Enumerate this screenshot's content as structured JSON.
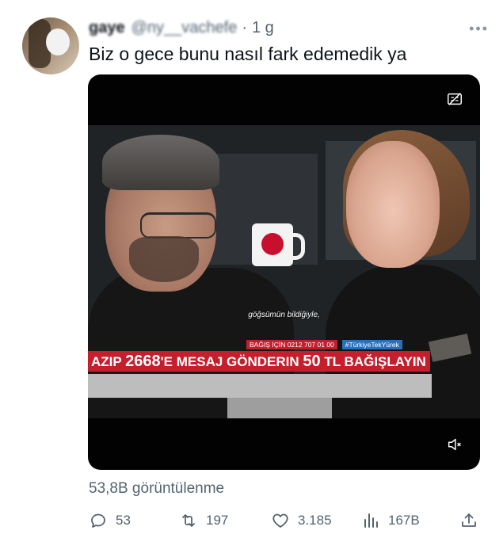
{
  "tweet": {
    "author_name": "gaye",
    "handle": "@ny__vachefe",
    "separator": "·",
    "time": "1 g",
    "more": "•••",
    "text": "Biz o gece bunu nasıl fark edemedik ya"
  },
  "media": {
    "subtitle": "göğsümün bildiğiyle,",
    "donation_phone": "BAĞIŞ İÇİN 0212 707 01 00",
    "hashtag": "#TürkiyeTekYürek",
    "ticker_pre": "AZIP ",
    "ticker_number": "2668",
    "ticker_mid": "'E MESAJ GÖNDERIN ",
    "ticker_amount": "50",
    "ticker_post": " TL BAĞIŞLAYIN",
    "icons": [
      "no-captions-icon",
      "mute-icon"
    ]
  },
  "stats": {
    "views": "53,8B görüntülenme",
    "replies": "53",
    "retweets": "197",
    "likes": "3.185",
    "analytics": "167B"
  },
  "colors": {
    "text_primary": "#0f1419",
    "text_secondary": "#536471",
    "ticker_red": "#c51e2c"
  }
}
